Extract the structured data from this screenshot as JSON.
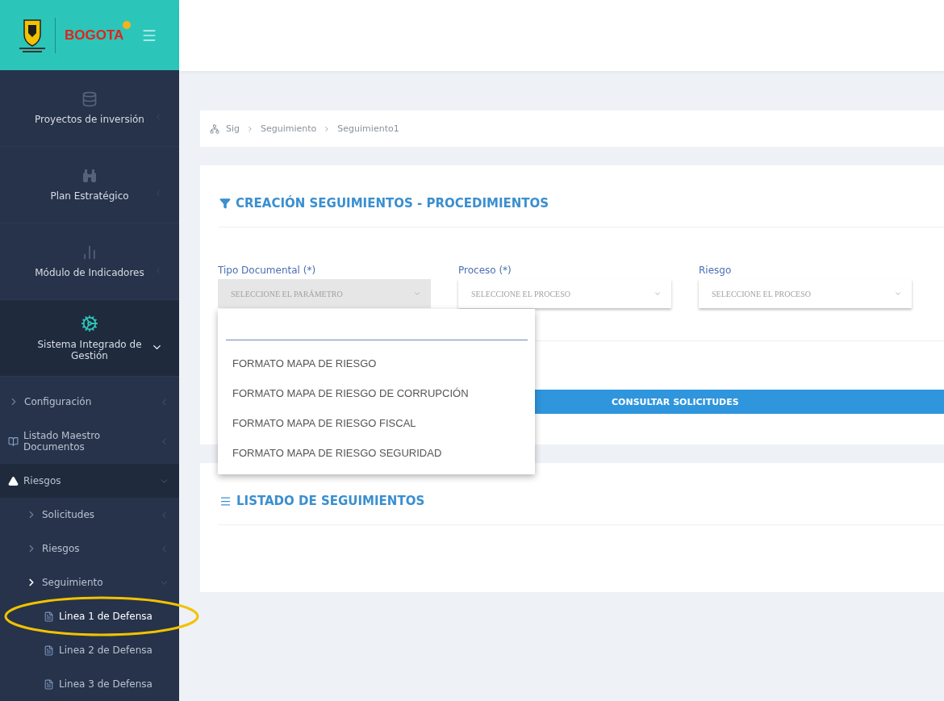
{
  "logo": {
    "wordmark": "BOGOTA"
  },
  "sidebar": {
    "modules": [
      {
        "label": "Proyectos de inversión",
        "kind": "database",
        "expanded": false
      },
      {
        "label": "Plan Estratégico",
        "kind": "binoculars",
        "expanded": false
      },
      {
        "label": "Módulo de Indicadores",
        "kind": "chart",
        "expanded": false
      },
      {
        "label": "Sistema Integrado de Gestión",
        "kind": "gears",
        "expanded": true
      }
    ],
    "items": [
      {
        "label": "Configuración",
        "kind": "chevron",
        "expanded": false,
        "selected": false
      },
      {
        "label": "Listado Maestro Documentos",
        "kind": "book",
        "expanded": false,
        "selected": false
      },
      {
        "label": "Riesgos",
        "kind": "warning",
        "expanded": true,
        "selected": false,
        "children": [
          {
            "label": "Solicitudes",
            "kind": "chevron",
            "expanded": false,
            "selected": false
          },
          {
            "label": "Riesgos",
            "kind": "chevron",
            "expanded": false,
            "selected": false
          },
          {
            "label": "Seguimiento",
            "kind": "chevron",
            "expanded": true,
            "selected": false,
            "children": [
              {
                "label": "Linea 1 de Defensa",
                "kind": "file",
                "selected": true
              },
              {
                "label": "Linea 2 de Defensa",
                "kind": "file",
                "selected": false
              },
              {
                "label": "Linea 3 de Defensa",
                "kind": "file",
                "selected": false
              }
            ]
          }
        ]
      }
    ]
  },
  "breadcrumb": [
    "Sig",
    "Seguimiento",
    "Seguimiento1"
  ],
  "form": {
    "title": "CREACIÓN SEGUIMIENTOS - PROCEDIMIENTOS",
    "fields": [
      {
        "label": "Tipo Documental (*)",
        "value": "SELECCIONE EL PARÁMETRO",
        "open": true
      },
      {
        "label": "Proceso (*)",
        "value": "SELECCIONE EL PROCESO",
        "open": false
      },
      {
        "label": "Riesgo",
        "value": "SELECCIONE EL PROCESO",
        "open": false
      }
    ],
    "dropdown_options": [
      "FORMATO MAPA DE RIESGO",
      "FORMATO MAPA DE RIESGO DE CORRUPCIÓN",
      "FORMATO MAPA DE RIESGO FISCAL",
      "FORMATO MAPA DE RIESGO SEGURIDAD"
    ],
    "button": "CONSULTAR SOLICITUDES"
  },
  "list": {
    "title": "LISTADO DE SEGUIMIENTOS"
  }
}
